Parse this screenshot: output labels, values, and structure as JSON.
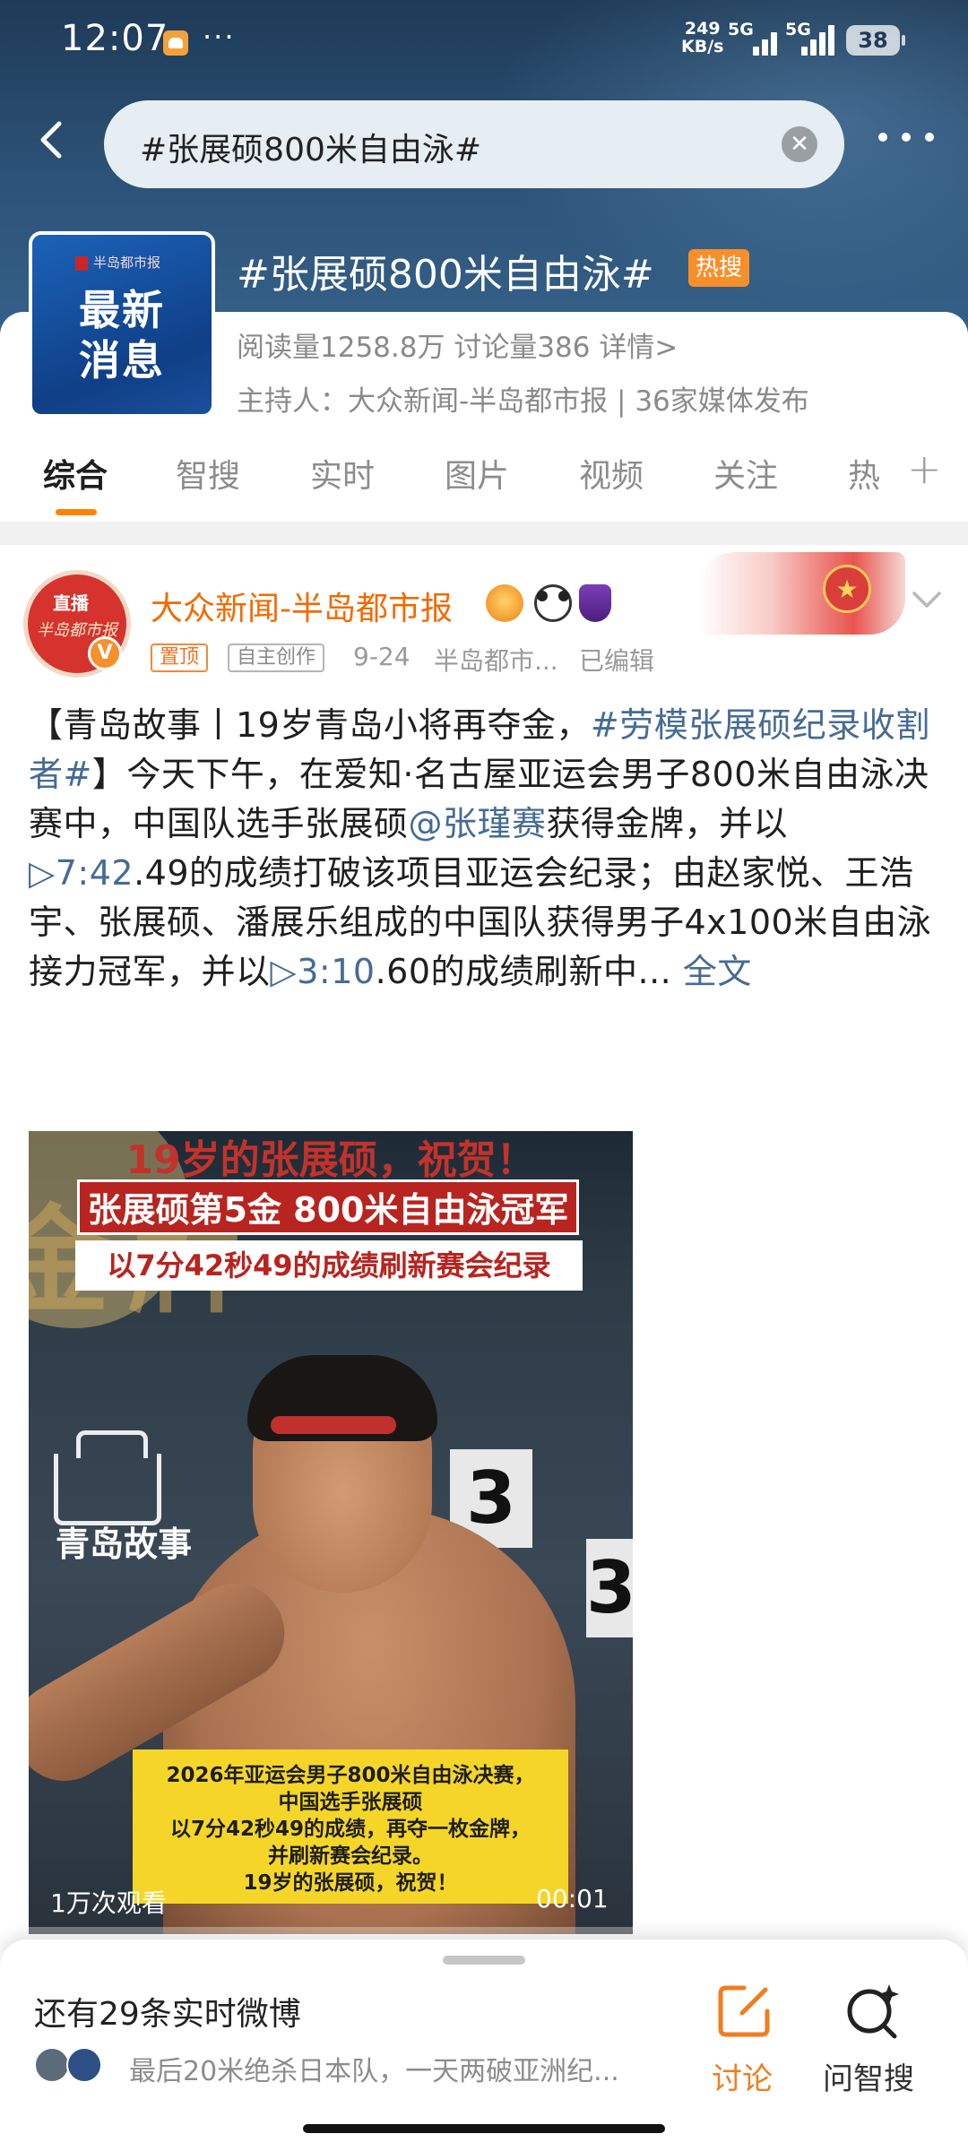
{
  "status_bar": {
    "time": "12:07",
    "dots": "···",
    "speed_value": "249",
    "speed_unit": "KB/s",
    "net1": "5G",
    "net2": "5G",
    "battery": "38"
  },
  "search": {
    "query": "#张展硕800米自由泳#",
    "clear_symbol": "✕"
  },
  "topic": {
    "cover": {
      "brand": "半岛都市报",
      "line1": "最新",
      "line2": "消息"
    },
    "title": "#张展硕800米自由泳#",
    "hot_badge": "热搜",
    "stats": "阅读量1258.8万   讨论量386   详情>",
    "host": "主持人：大众新闻-半岛都市报 | 36家媒体发布"
  },
  "tabs": [
    {
      "label": "综合",
      "active": true
    },
    {
      "label": "智搜",
      "active": false
    },
    {
      "label": "实时",
      "active": false
    },
    {
      "label": "图片",
      "active": false
    },
    {
      "label": "视频",
      "active": false
    },
    {
      "label": "关注",
      "active": false
    },
    {
      "label": "热",
      "active": false
    }
  ],
  "tab_add": "+",
  "post": {
    "avatar": {
      "live": "直播",
      "name": "半岛都市报",
      "badge": "V"
    },
    "author": "大众新闻-半岛都市报",
    "tags": {
      "pin": "置顶",
      "original": "自主创作"
    },
    "date": "9-24",
    "source": "半岛都市...",
    "edited": "已编辑",
    "body": {
      "p1": "【青岛故事丨19岁青岛小将再夺金，",
      "hashtag": "#劳模张展硕纪录收割者#",
      "p2": "】今天下午，在爱知·名古屋亚运会男子800米自由泳决赛中，中国队选手张展硕",
      "mention": "@张瑾赛",
      "p3": "获得金牌，并以",
      "video_time1": "▷7:42",
      "p4": ".49的成绩打破该项目亚运会纪录；由赵家悦、王浩宇、张展硕、潘展乐组成的中国队获得男子4x100米自由泳接力冠军，并以",
      "video_time2": "▷3:10",
      "p5": ".60的成绩刷新中...",
      "full_text": "全文"
    },
    "video": {
      "headline": "19岁的张展硕，祝贺！",
      "banner1": "张展硕第5金  800米自由泳冠军",
      "banner2": "以7分42秒49的成绩刷新赛会纪录",
      "gold_text": "金牌",
      "logo_text": "青岛故事",
      "lane_number": "3",
      "caption": [
        "2026年亚运会男子800米自由泳决赛，",
        "中国选手张展硕",
        "以7分42秒49的成绩，再夺一枚金牌，",
        "并刷新赛会纪录。",
        "19岁的张展硕，祝贺！"
      ],
      "views": "1万次观看",
      "duration": "00:01"
    }
  },
  "bottom": {
    "more_realtime": "还有29条实时微博",
    "preview": "最后20米绝杀日本队，一天两破亚洲纪...",
    "discuss": "讨论",
    "ask": "问智搜"
  },
  "colors": {
    "accent": "#ff8200",
    "link": "#466b95",
    "header_dark": "#1e3a57"
  }
}
